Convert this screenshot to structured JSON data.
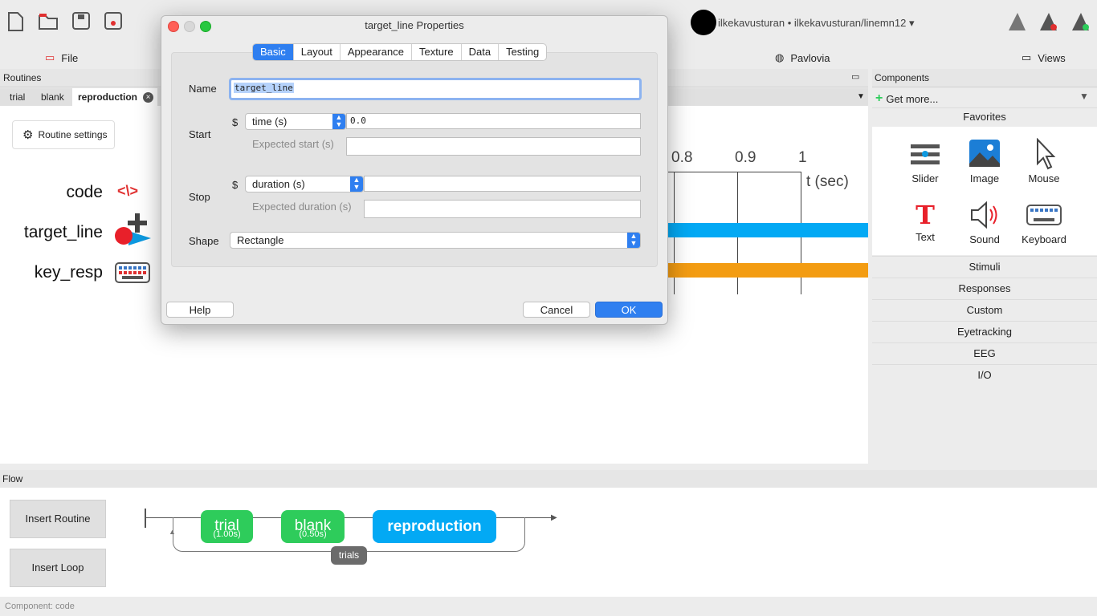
{
  "menubar": {
    "file": "File",
    "pavlovia": "Pavlovia",
    "views": "Views"
  },
  "user": {
    "label": "ilkekavusturan • ilkekavusturan/linemn12 ▾"
  },
  "routines": {
    "header": "Routines",
    "tabs": [
      {
        "label": "trial"
      },
      {
        "label": "blank"
      },
      {
        "label": "reproduction"
      }
    ],
    "settings_button": "Routine settings",
    "components": [
      {
        "label": "code"
      },
      {
        "label": "target_line"
      },
      {
        "label": "key_resp"
      }
    ],
    "timeline": {
      "ticks": [
        "0.8",
        "0.9",
        "1"
      ],
      "axis_label": "t (sec)"
    }
  },
  "components_panel": {
    "header": "Components",
    "get_more": "Get more...",
    "favorites_header": "Favorites",
    "favorites": [
      {
        "label": "Slider"
      },
      {
        "label": "Image"
      },
      {
        "label": "Mouse"
      },
      {
        "label": "Text"
      },
      {
        "label": "Sound"
      },
      {
        "label": "Keyboard"
      }
    ],
    "categories": [
      "Stimuli",
      "Responses",
      "Custom",
      "Eyetracking",
      "EEG",
      "I/O"
    ]
  },
  "flow": {
    "header": "Flow",
    "insert_routine": "Insert Routine",
    "insert_loop": "Insert Loop",
    "routines": [
      {
        "name": "trial",
        "duration": "(1.00s)",
        "color": "#2ecc5b"
      },
      {
        "name": "blank",
        "duration": "(0.50s)",
        "color": "#2ecc5b"
      },
      {
        "name": "reproduction",
        "duration": "",
        "color": "#03a9f4"
      }
    ],
    "loop_label": "trials"
  },
  "status": {
    "text": "Component: code"
  },
  "dialog": {
    "title": "target_line Properties",
    "tabs": [
      "Basic",
      "Layout",
      "Appearance",
      "Texture",
      "Data",
      "Testing"
    ],
    "active_tab": "Basic",
    "name_label": "Name",
    "name_value": "target_line",
    "start_label": "Start",
    "start_type": "time (s)",
    "start_value": "0.0",
    "expected_start_label": "Expected start (s)",
    "expected_start_value": "",
    "stop_label": "Stop",
    "stop_type": "duration (s)",
    "stop_value": "",
    "expected_duration_label": "Expected duration (s)",
    "expected_duration_value": "",
    "shape_label": "Shape",
    "shape_value": "Rectangle",
    "dollar": "$",
    "help_button": "Help",
    "cancel_button": "Cancel",
    "ok_button": "OK"
  },
  "colors": {
    "accent": "#2f7ff0",
    "code_bar": "#03a9f4",
    "key_bar": "#f39c12",
    "green": "#2ecc5b"
  }
}
